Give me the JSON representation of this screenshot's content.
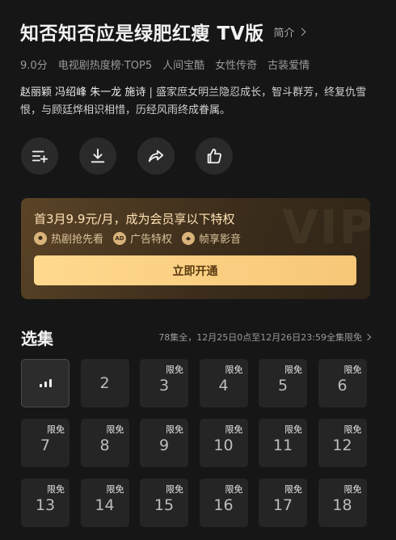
{
  "header": {
    "title": "知否知否应是绿肥红瘦 TV版",
    "intro_label": "简介"
  },
  "tags": [
    "9.0分",
    "电视剧热度榜·TOP5",
    "人间宝酷",
    "女性传奇",
    "古装爱情"
  ],
  "description": {
    "cast": "赵丽颖 冯绍峰 朱一龙 施诗",
    "separator": " | ",
    "summary": "盛家庶女明兰隐忍成长，智斗群芳，终复仇雪恨，与顾廷烨相识相惜，历经风雨终成眷属。"
  },
  "actions": [
    {
      "name": "add-to-playlist-icon"
    },
    {
      "name": "download-icon"
    },
    {
      "name": "share-icon"
    },
    {
      "name": "like-icon"
    }
  ],
  "vip": {
    "watermark": "VIP",
    "title": "首3月9.9元/月，成为会员享以下特权",
    "perks": [
      {
        "icon_text": "",
        "label": "热剧抢先看"
      },
      {
        "icon_text": "AD",
        "label": "广告特权"
      },
      {
        "icon_text": "",
        "label": "帧享影音"
      }
    ],
    "button_label": "立即开通",
    "accent": "#f7c778"
  },
  "episodes": {
    "title": "选集",
    "info": "78集全，12月25日0点至12月26日23:59全集限免",
    "items": [
      {
        "number": "",
        "badge": "",
        "current": true
      },
      {
        "number": "2",
        "badge": ""
      },
      {
        "number": "3",
        "badge": "限免"
      },
      {
        "number": "4",
        "badge": "限免"
      },
      {
        "number": "5",
        "badge": "限免"
      },
      {
        "number": "6",
        "badge": "限免"
      },
      {
        "number": "7",
        "badge": "限免"
      },
      {
        "number": "8",
        "badge": "限免"
      },
      {
        "number": "9",
        "badge": "限免"
      },
      {
        "number": "10",
        "badge": "限免"
      },
      {
        "number": "11",
        "badge": "限免"
      },
      {
        "number": "12",
        "badge": "限免"
      },
      {
        "number": "13",
        "badge": "限免"
      },
      {
        "number": "14",
        "badge": "限免"
      },
      {
        "number": "15",
        "badge": "限免"
      },
      {
        "number": "16",
        "badge": "限免"
      },
      {
        "number": "17",
        "badge": "限免"
      },
      {
        "number": "18",
        "badge": "限免"
      }
    ]
  }
}
